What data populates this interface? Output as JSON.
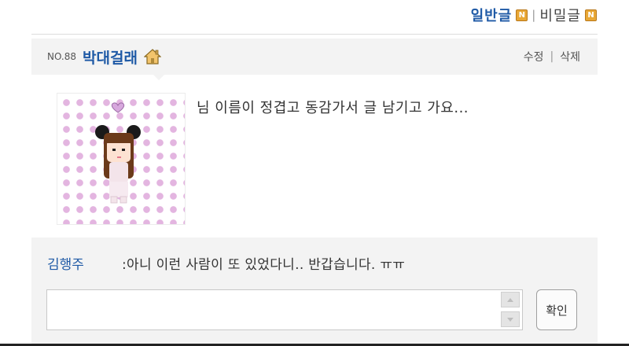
{
  "tabs": {
    "general": "일반글",
    "secret": "비밀글",
    "badge": "N",
    "separator": "|"
  },
  "post": {
    "number": "NO.88",
    "author": "박대걸래",
    "edit_label": "수정",
    "delete_label": "삭제",
    "actions_separator": "|",
    "body": "님 이름이 정겹고 동감가서 글 남기고 가요..."
  },
  "comment": {
    "author": "김행주",
    "text": ":아니 이런 사람이 또 있었다니.. 반갑습니다. ㅠㅠ"
  },
  "reply": {
    "input_value": "",
    "confirm_label": "확인"
  },
  "colors": {
    "author_blue": "#1f5aa6",
    "header_bg": "#f3f3f3",
    "badge_orange": "#e8a735",
    "avatar_dots": "#e3b5e0"
  },
  "icons": {
    "home": "home-icon",
    "avatar": "pixel-avatar"
  }
}
